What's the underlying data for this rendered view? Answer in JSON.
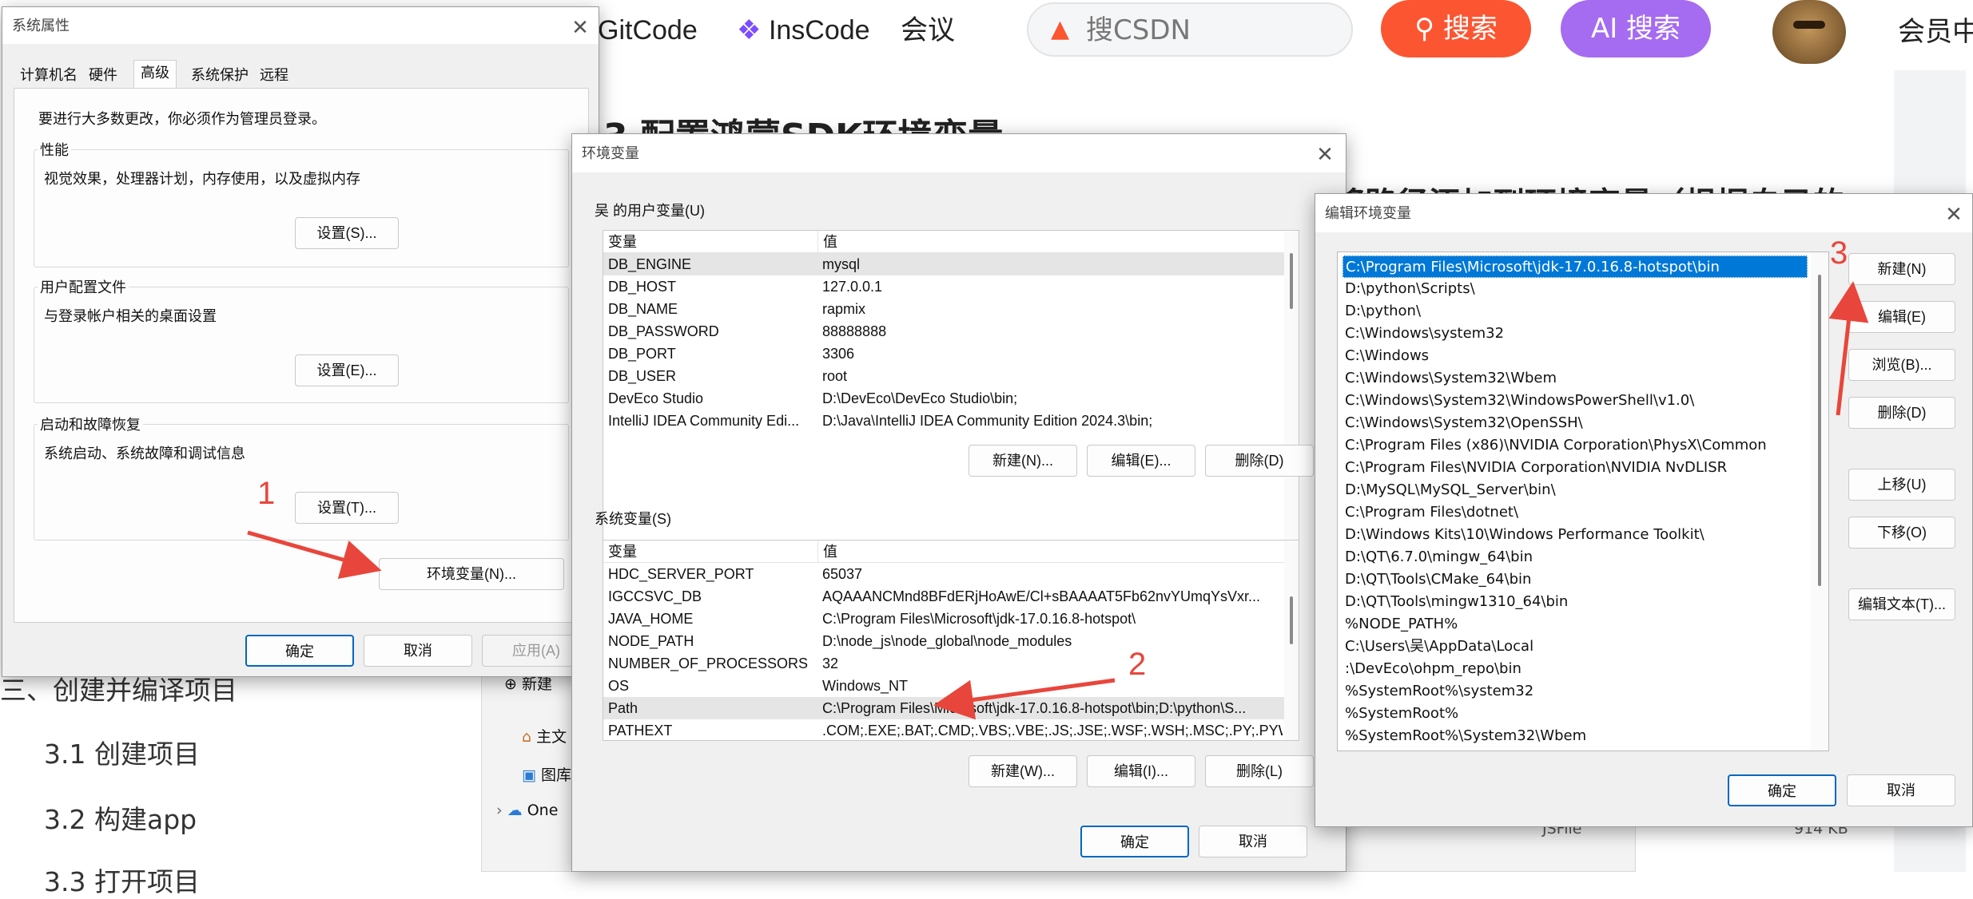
{
  "web": {
    "nav": {
      "gitcode": "GitCode",
      "inscode": "InsCode",
      "meeting": "会议",
      "search_placeholder": "搜CSDN",
      "search_btn": "搜索",
      "ai_search_btn": "AI 搜索",
      "member": "会员中"
    },
    "article_heading": "3 配置鸿蒙SDK环境变量",
    "article_text": "将路径添加到环境变量（根据自己的",
    "toc": {
      "section": "三、创建并编译项目",
      "item1": "3.1 创建项目",
      "item2": "3.2 构建app",
      "item3": "3.3 打开项目"
    },
    "explorer": {
      "new": "新建",
      "home": "主文",
      "gallery": "图库",
      "onedrive": "One",
      "file_type": "JSFile",
      "file_size": "914 KB"
    }
  },
  "sysprops": {
    "title": "系统属性",
    "tabs": [
      "计算机名",
      "硬件",
      "高级",
      "系统保护",
      "远程"
    ],
    "active_tab": "高级",
    "notice": "要进行大多数更改，你必须作为管理员登录。",
    "perf_label": "性能",
    "perf_desc": "视觉效果，处理器计划，内存使用，以及虚拟内存",
    "perf_btn": "设置(S)...",
    "profile_label": "用户配置文件",
    "profile_desc": "与登录帐户相关的桌面设置",
    "profile_btn": "设置(E)...",
    "startup_label": "启动和故障恢复",
    "startup_desc": "系统启动、系统故障和调试信息",
    "startup_btn": "设置(T)...",
    "env_btn": "环境变量(N)...",
    "ok": "确定",
    "cancel": "取消",
    "apply": "应用(A)"
  },
  "envvars": {
    "title": "环境变量",
    "user_label": "吴 的用户变量(U)",
    "col_var": "变量",
    "col_val": "值",
    "user_rows": [
      {
        "name": "DB_ENGINE",
        "value": "mysql"
      },
      {
        "name": "DB_HOST",
        "value": "127.0.0.1"
      },
      {
        "name": "DB_NAME",
        "value": "rapmix"
      },
      {
        "name": "DB_PASSWORD",
        "value": "88888888"
      },
      {
        "name": "DB_PORT",
        "value": "3306"
      },
      {
        "name": "DB_USER",
        "value": "root"
      },
      {
        "name": "DevEco Studio",
        "value": "D:\\DevEco\\DevEco Studio\\bin;"
      },
      {
        "name": "IntelliJ IDEA Community Edi...",
        "value": "D:\\Java\\IntelliJ IDEA Community Edition 2024.3\\bin;"
      }
    ],
    "user_new": "新建(N)...",
    "user_edit": "编辑(E)...",
    "user_delete": "删除(D)",
    "sys_label": "系统变量(S)",
    "sys_rows": [
      {
        "name": "HDC_SERVER_PORT",
        "value": "65037"
      },
      {
        "name": "IGCCSVC_DB",
        "value": "AQAAANCMnd8BFdERjHoAwE/Cl+sBAAAAT5Fb62nvYUmqYsVxr..."
      },
      {
        "name": "JAVA_HOME",
        "value": "C:\\Program Files\\Microsoft\\jdk-17.0.16.8-hotspot\\"
      },
      {
        "name": "NODE_PATH",
        "value": "D:\\node_js\\node_global\\node_modules"
      },
      {
        "name": "NUMBER_OF_PROCESSORS",
        "value": "32"
      },
      {
        "name": "OS",
        "value": "Windows_NT"
      },
      {
        "name": "Path",
        "value": "C:\\Program Files\\Microsoft\\jdk-17.0.16.8-hotspot\\bin;D:\\python\\S..."
      },
      {
        "name": "PATHEXT",
        "value": ".COM;.EXE;.BAT;.CMD;.VBS;.VBE;.JS;.JSE;.WSF;.WSH;.MSC;.PY;.PYW"
      }
    ],
    "sys_new": "新建(W)...",
    "sys_edit": "编辑(I)...",
    "sys_delete": "删除(L)",
    "ok": "确定",
    "cancel": "取消"
  },
  "editenv": {
    "title": "编辑环境变量",
    "items": [
      "C:\\Program Files\\Microsoft\\jdk-17.0.16.8-hotspot\\bin",
      "D:\\python\\Scripts\\",
      "D:\\python\\",
      "C:\\Windows\\system32",
      "C:\\Windows",
      "C:\\Windows\\System32\\Wbem",
      "C:\\Windows\\System32\\WindowsPowerShell\\v1.0\\",
      "C:\\Windows\\System32\\OpenSSH\\",
      "C:\\Program Files (x86)\\NVIDIA Corporation\\PhysX\\Common",
      "C:\\Program Files\\NVIDIA Corporation\\NVIDIA NvDLISR",
      "D:\\MySQL\\MySQL_Server\\bin\\",
      "C:\\Program Files\\dotnet\\",
      "D:\\Windows Kits\\10\\Windows Performance Toolkit\\",
      "D:\\QT\\6.7.0\\mingw_64\\bin",
      "D:\\QT\\Tools\\CMake_64\\bin",
      "D:\\QT\\Tools\\mingw1310_64\\bin",
      "%NODE_PATH%",
      "C:\\Users\\吴\\AppData\\Local",
      ":\\DevEco\\ohpm_repo\\bin",
      "%SystemRoot%\\system32",
      "%SystemRoot%",
      "%SystemRoot%\\System32\\Wbem"
    ],
    "btn_new": "新建(N)",
    "btn_edit": "编辑(E)",
    "btn_browse": "浏览(B)...",
    "btn_delete": "删除(D)",
    "btn_up": "上移(U)",
    "btn_down": "下移(O)",
    "btn_edit_text": "编辑文本(T)...",
    "ok": "确定",
    "cancel": "取消"
  },
  "annotations": {
    "step1": "1",
    "step2": "2",
    "step3": "3"
  },
  "colors": {
    "accent_red": "#fc5531",
    "ai_purple": "#a56bf0",
    "selection_blue": "#0078d7",
    "annotation_red": "#e8463c"
  }
}
